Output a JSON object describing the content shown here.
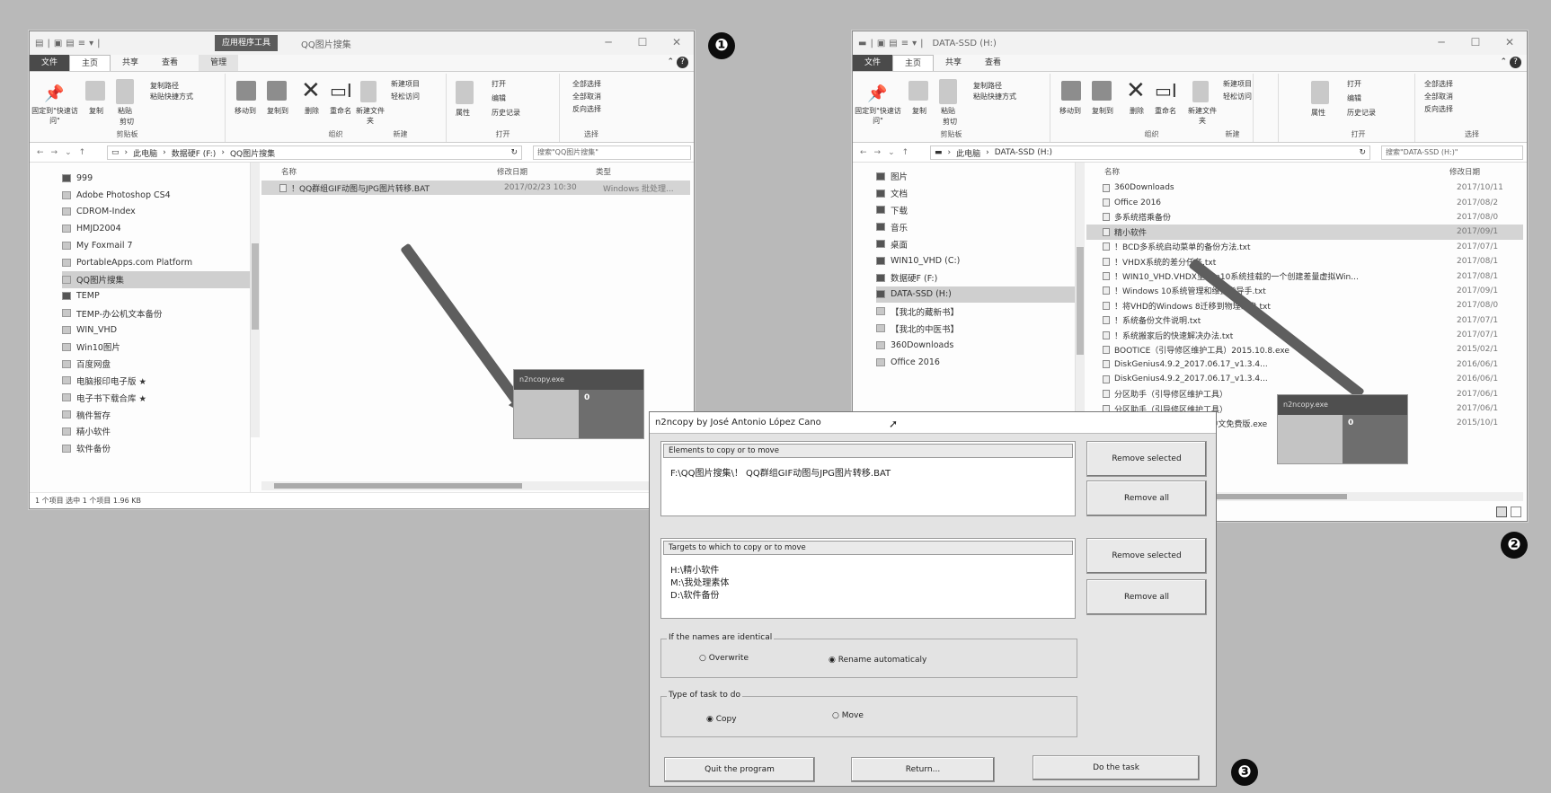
{
  "left_window": {
    "context_tab": "应用程序工具",
    "title": "QQ图片搜集",
    "tabs": [
      "文件",
      "主页",
      "共享",
      "查看",
      "管理"
    ],
    "ribbon": {
      "pin": "固定到\"快速访问\"",
      "copy": "复制",
      "paste": "粘贴",
      "copy_path": "复制路径",
      "paste_shortcut": "粘贴快捷方式",
      "cut": "剪切",
      "clipboard": "剪贴板",
      "move_to": "移动到",
      "copy_to": "复制到",
      "delete": "删除",
      "rename": "重命名",
      "organize": "组织",
      "new_folder": "新建文件夹",
      "new_item": "新建项目",
      "easy_access": "轻松访问",
      "new": "新建",
      "properties": "属性",
      "open": "打开",
      "edit": "编辑",
      "history": "历史记录",
      "open_group": "打开",
      "select_all": "全部选择",
      "select_none": "全部取消",
      "invert": "反向选择",
      "select": "选择"
    },
    "address": [
      "此电脑",
      "数据硬F (F:)",
      "QQ图片搜集"
    ],
    "search_placeholder": "搜索\"QQ图片搜集\"",
    "nav_items": [
      {
        "label": "999",
        "dark": true
      },
      {
        "label": "Adobe Photoshop CS4"
      },
      {
        "label": "CDROM-Index"
      },
      {
        "label": "HMJD2004"
      },
      {
        "label": "My Foxmail 7"
      },
      {
        "label": "PortableApps.com Platform"
      },
      {
        "label": "QQ图片搜集",
        "selected": true
      },
      {
        "label": "TEMP",
        "dark": true
      },
      {
        "label": "TEMP-办公机文本备份"
      },
      {
        "label": "WIN_VHD"
      },
      {
        "label": "Win10图片"
      },
      {
        "label": "百度网盘"
      },
      {
        "label": "电脑报印电子版 ★"
      },
      {
        "label": "电子书下载合库 ★"
      },
      {
        "label": "稿件暂存"
      },
      {
        "label": "精小软件"
      },
      {
        "label": "软件备份"
      }
    ],
    "columns": [
      "名称",
      "修改日期",
      "类型"
    ],
    "files": [
      {
        "name": "！QQ群组GIF动图与JPG图片转移.BAT",
        "date": "2017/02/23 10:30",
        "type": "Windows 批处理..."
      }
    ],
    "status": "1 个项目    选中 1 个项目  1.96 KB"
  },
  "right_window": {
    "title": "DATA-SSD (H:)",
    "tabs": [
      "文件",
      "主页",
      "共享",
      "查看"
    ],
    "address": [
      "此电脑",
      "DATA-SSD (H:)"
    ],
    "search_placeholder": "搜索\"DATA-SSD (H:)\"",
    "nav_items": [
      {
        "label": "图片",
        "dark": true
      },
      {
        "label": "文档",
        "dark": true
      },
      {
        "label": "下载",
        "dark": true
      },
      {
        "label": "音乐",
        "dark": true
      },
      {
        "label": "桌面",
        "dark": true
      },
      {
        "label": "WIN10_VHD (C:)",
        "dark": true
      },
      {
        "label": "数据硬F (F:)",
        "dark": true
      },
      {
        "label": "DATA-SSD (H:)",
        "dark": true,
        "selected": true
      },
      {
        "label": "【我北的藏新书】"
      },
      {
        "label": "【我北的中医书】"
      },
      {
        "label": "360Downloads"
      },
      {
        "label": "Office 2016"
      }
    ],
    "columns": [
      "名称",
      "修改日期"
    ],
    "files": [
      {
        "name": "360Downloads",
        "date": "2017/10/11"
      },
      {
        "name": "Office 2016",
        "date": "2017/08/2"
      },
      {
        "name": "多系统搭乘备份",
        "date": "2017/08/0"
      },
      {
        "name": "精小软件",
        "date": "2017/09/1",
        "selected": true
      },
      {
        "name": "！BCD多系统启动菜单的备份方法.txt",
        "date": "2017/07/1"
      },
      {
        "name": "！VHDX系统的差分任务.txt",
        "date": "2017/08/1"
      },
      {
        "name": "！WIN10_VHD.VHDX里Win10系统挂载的一个创建差量虚拟Win...",
        "date": "2017/08/1"
      },
      {
        "name": "！Windows 10系统管理和维护指导手.txt",
        "date": "2017/09/1"
      },
      {
        "name": "！将VHD的Windows 8迁移到物理硬盘.txt",
        "date": "2017/08/0"
      },
      {
        "name": "！系统备份文件说明.txt",
        "date": "2017/07/1"
      },
      {
        "name": "！系统搬家后的快速解决办法.txt",
        "date": "2017/07/1"
      },
      {
        "name": "BOOTICE（引导修区维护工具）2015.10.8.exe",
        "date": "2015/02/1"
      },
      {
        "name": "DiskGenius4.9.2_2017.06.17_v1.3.4...",
        "date": "2016/06/1"
      },
      {
        "name": "DiskGenius4.9.2_2017.06.17_v1.3.4...",
        "date": "2016/06/1"
      },
      {
        "name": "分区助手（引导修区维护工具）",
        "date": "2017/06/1"
      },
      {
        "name": "分区助手（引导修区维护工具）",
        "date": "2017/06/1"
      },
      {
        "name": "分区助手修复工具2.3.207中文免费版.exe",
        "date": "2015/10/1"
      }
    ]
  },
  "drag_label": "n2ncopy.exe",
  "drag_count": "0",
  "badges": [
    "❶",
    "❷",
    "❸"
  ],
  "dialog": {
    "title": "n2ncopy by José Antonio López Cano",
    "elements_header": "Elements to copy or to move",
    "elements": [
      "F:\\QQ图片搜集\\！ QQ群组GIF动图与JPG图片转移.BAT"
    ],
    "targets_header": "Targets to which to copy or to move",
    "targets": [
      "H:\\精小软件",
      "M:\\我处理素体",
      "D:\\软件备份"
    ],
    "remove_selected": "Remove selected",
    "remove_all": "Remove all",
    "identical_group": "If the names are identical",
    "overwrite": "Overwrite",
    "rename": "Rename automaticaly",
    "task_group": "Type of task to do",
    "copy": "Copy",
    "move": "Move",
    "quit": "Quit the program",
    "return": "Return...",
    "do_task": "Do the task"
  }
}
